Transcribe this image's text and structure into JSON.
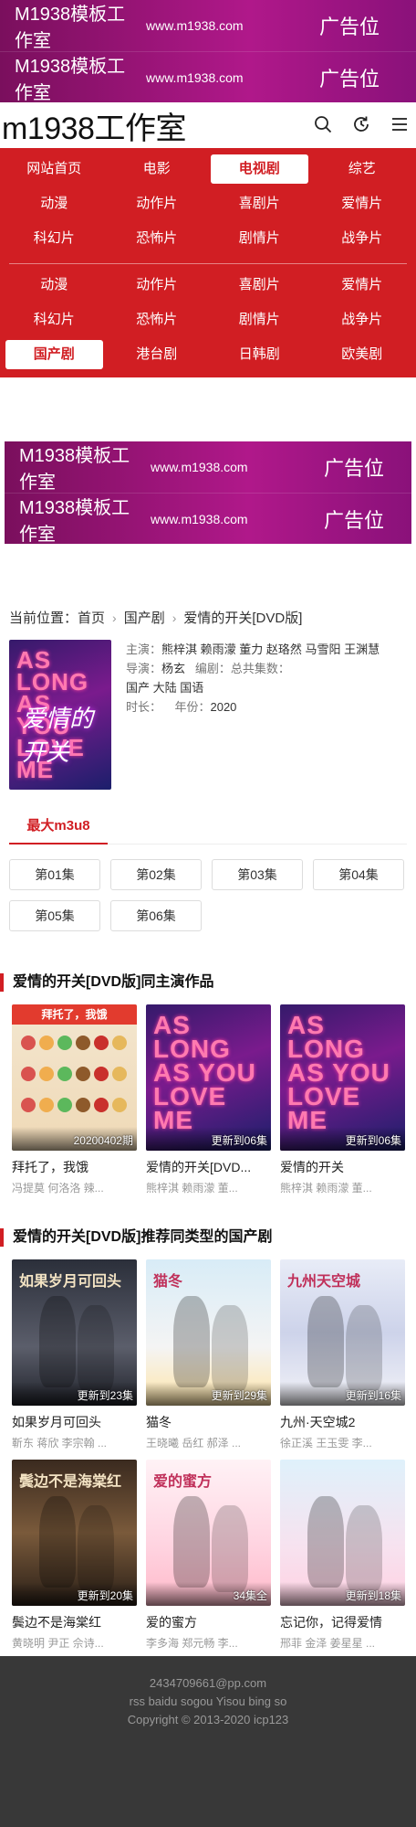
{
  "ad": {
    "name": "M1938模板工作室",
    "url": "www.m1938.com",
    "tag": "广告位"
  },
  "header": {
    "logo": "m1938工作室",
    "icons": [
      "search-icon",
      "history-icon",
      "menu-icon"
    ]
  },
  "nav": {
    "top_rows": [
      [
        "网站首页",
        "电影",
        "电视剧",
        "综艺"
      ],
      [
        "动漫",
        "动作片",
        "喜剧片",
        "爱情片"
      ],
      [
        "科幻片",
        "恐怖片",
        "剧情片",
        "战争片"
      ]
    ],
    "sub_rows": [
      [
        "动漫",
        "动作片",
        "喜剧片",
        "爱情片"
      ],
      [
        "科幻片",
        "恐怖片",
        "剧情片",
        "战争片"
      ],
      [
        "国产剧",
        "港台剧",
        "日韩剧",
        "欧美剧"
      ]
    ],
    "active_top": "电视剧",
    "active_sub": "国产剧",
    "accent_color": "#d11e23"
  },
  "breadcrumb": {
    "label": "当前位置：",
    "home": "首页",
    "category": "国产剧",
    "current": "爱情的开关[DVD版]",
    "separator": "›"
  },
  "detail": {
    "poster_title_en": "AS LONG AS YOU LOVE ME",
    "poster_title_cn": "爱情的开关",
    "cast_label": "主演：",
    "cast": "熊梓淇  赖雨濛  董力  赵珞然  马雪阳  王渊慧",
    "director_label": "导演：",
    "director": "杨玄",
    "writer_label": "编剧：",
    "total_label": "总共集数：",
    "region_lang": "国产  大陆  国语",
    "duration_label": "时长：",
    "year_label": "年份：",
    "year": "2020"
  },
  "source_tab": "最大m3u8",
  "episodes": [
    "第01集",
    "第02集",
    "第03集",
    "第04集",
    "第05集",
    "第06集"
  ],
  "sections": [
    {
      "title": "爱情的开关[DVD版]同主演作品",
      "items": [
        {
          "title": "拜托了，我饿",
          "badge": "20200402期",
          "actors": "冯提莫  何洛洛  辣...",
          "poster_text": "拜托了，我饿",
          "style": "p-food"
        },
        {
          "title": "爱情的开关[DVD...",
          "badge": "更新到06集",
          "actors": "熊梓淇  赖雨濛  董...",
          "poster_text": "AS LONG AS YOU LOVE ME",
          "style": "p-love"
        },
        {
          "title": "爱情的开关",
          "badge": "更新到06集",
          "actors": "熊梓淇  赖雨濛  董...",
          "poster_text": "AS LONG AS YOU LOVE ME",
          "style": "p-love"
        }
      ]
    },
    {
      "title": "爱情的开关[DVD版]推荐同类型的国产剧",
      "items": [
        {
          "title": "如果岁月可回头",
          "badge": "更新到23集",
          "actors": "靳东  蒋欣  李宗翰  ...",
          "poster_text": "如果岁月可回头",
          "style": "p-dark"
        },
        {
          "title": "猫冬",
          "badge": "更新到29集",
          "actors": "王晓曦  岳红  郝泽  ...",
          "poster_text": "猫冬",
          "style": "p-cat"
        },
        {
          "title": "九州·天空城2",
          "badge": "更新到16集",
          "actors": "徐正溪  王玉雯  李...",
          "poster_text": "九州天空城",
          "style": "p-fairy"
        },
        {
          "title": "鬓边不是海棠红",
          "badge": "更新到20集",
          "actors": "黄晓明  尹正  佘诗...",
          "poster_text": "鬓边不是海棠红",
          "style": "p-opera"
        },
        {
          "title": "爱的蜜方",
          "badge": "34集全",
          "actors": "李多海  郑元畅  李...",
          "poster_text": "爱的蜜方",
          "style": "p-honey"
        },
        {
          "title": "忘记你，记得爱情",
          "badge": "更新到18集",
          "actors": "邢菲  金泽  姜星星  ...",
          "poster_text": "",
          "style": "p-remember"
        }
      ]
    }
  ],
  "footer": {
    "line1": "2434709661@pp.com",
    "line2": "rss baidu sogou Yisou bing so",
    "line3": "Copyright © 2013-2020 icp123"
  }
}
